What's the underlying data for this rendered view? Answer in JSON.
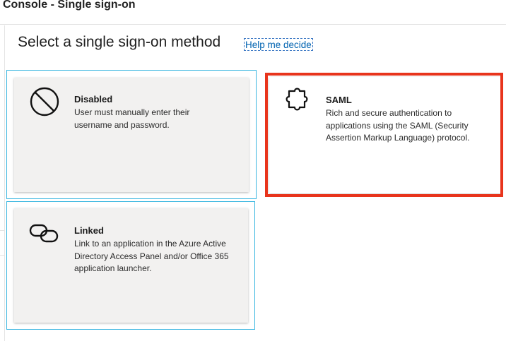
{
  "window": {
    "title": "Console - Single sign-on"
  },
  "page": {
    "heading": "Select a single sign-on method",
    "help_link": "Help me decide"
  },
  "methods": [
    {
      "title": "Disabled",
      "description": "User must manually enter their username and password.",
      "icon": "blocked-circle-icon",
      "selected": true
    },
    {
      "title": "SAML",
      "description": "Rich and secure authentication to applications using the SAML (Security Assertion Markup Language) protocol.",
      "icon": "puzzle-piece-icon",
      "highlighted": true,
      "highlight_color": "#e8341c"
    },
    {
      "title": "Linked",
      "description": "Link to an application in the Azure Active Directory Access Panel and/or Office 365 application launcher.",
      "icon": "chain-link-icon"
    }
  ],
  "colors": {
    "selection_outline": "#3ab6e0",
    "link": "#0063b1",
    "tile_background": "#f2f1f0",
    "highlight": "#e8341c"
  }
}
